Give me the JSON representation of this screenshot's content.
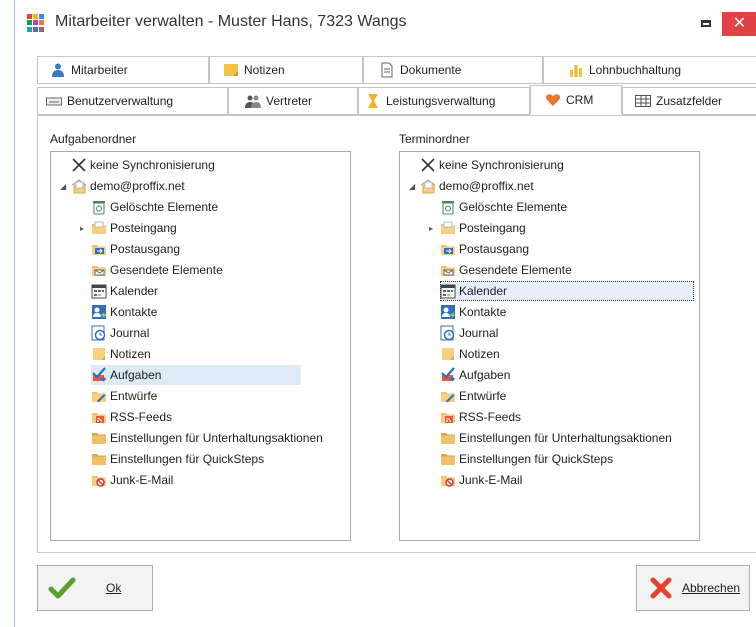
{
  "window": {
    "title": "Mitarbeiter verwalten - Muster Hans, 7323 Wangs",
    "minimize_icon": "minimize-icon",
    "close_glyph": "✕",
    "app_icon_colors": [
      "#e94235",
      "#f4b400",
      "#4285f4",
      "#0f9d58",
      "#ab47bc",
      "#ff7043",
      "#26a69a",
      "#5c6bc0",
      "#8d6e63"
    ]
  },
  "tabs": {
    "row1": [
      {
        "label": "Mitarbeiter",
        "icon": "person-icon"
      },
      {
        "label": "Notizen",
        "icon": "note-icon"
      },
      {
        "label": "Dokumente",
        "icon": "document-icon"
      },
      {
        "label": "Lohnbuchhaltung",
        "icon": "bar-chart-icon"
      }
    ],
    "row2": [
      {
        "label": "Benutzerverwaltung",
        "icon": "keyboard-icon"
      },
      {
        "label": "Vertreter",
        "icon": "people-icon"
      },
      {
        "label": "Leistungsverwaltung",
        "icon": "hourglass-icon"
      },
      {
        "label": "CRM",
        "icon": "heart-icon",
        "active": true
      },
      {
        "label": "Zusatzfelder",
        "icon": "table-icon"
      }
    ]
  },
  "left": {
    "label": "Aufgabenordner",
    "selected": "Aufgaben"
  },
  "right": {
    "label": "Terminordner",
    "selected": "Kalender"
  },
  "tree": {
    "no_sync": "keine Synchronisierung",
    "account": "demo@proffix.net",
    "items": [
      {
        "label": "Gelöschte Elemente",
        "icon": "trash-icon"
      },
      {
        "label": "Posteingang",
        "icon": "inbox-icon",
        "expandable": true
      },
      {
        "label": "Postausgang",
        "icon": "outbox-icon"
      },
      {
        "label": "Gesendete Elemente",
        "icon": "sent-icon"
      },
      {
        "label": "Kalender",
        "icon": "calendar-icon"
      },
      {
        "label": "Kontakte",
        "icon": "contacts-icon"
      },
      {
        "label": "Journal",
        "icon": "journal-icon"
      },
      {
        "label": "Notizen",
        "icon": "notes-icon"
      },
      {
        "label": "Aufgaben",
        "icon": "tasks-icon"
      },
      {
        "label": "Entwürfe",
        "icon": "drafts-icon"
      },
      {
        "label": "RSS-Feeds",
        "icon": "rss-icon"
      },
      {
        "label": "Einstellungen für Unterhaltungsaktionen",
        "icon": "folder-icon"
      },
      {
        "label": "Einstellungen für QuickSteps",
        "icon": "folder-icon"
      },
      {
        "label": "Junk-E-Mail",
        "icon": "junk-icon"
      }
    ]
  },
  "buttons": {
    "ok": "Ok",
    "cancel": "Abbrechen"
  },
  "colors": {
    "accent_close": "#e04343",
    "selection": "#dfeaf7",
    "check_green": "#5aa02c",
    "cancel_red": "#e5412d"
  }
}
